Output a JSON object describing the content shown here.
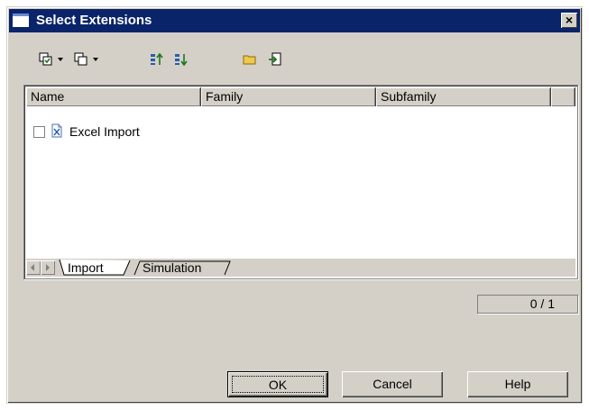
{
  "window": {
    "title": "Select Extensions",
    "close_label": "×"
  },
  "toolbar": {
    "icons": [
      "select-all-icon",
      "deselect-all-icon",
      "move-up-icon",
      "move-down-icon",
      "folder-icon",
      "import-icon"
    ]
  },
  "list": {
    "columns": [
      "Name",
      "Family",
      "Subfamily"
    ],
    "rows": [
      {
        "checked": false,
        "icon": "excel-import-icon",
        "name": "Excel Import",
        "family": "",
        "subfamily": ""
      }
    ],
    "tabs": [
      "Import",
      "Simulation"
    ],
    "active_tab": "Import"
  },
  "counter": "0 / 1",
  "buttons": {
    "ok": "OK",
    "cancel": "Cancel",
    "help": "Help"
  }
}
